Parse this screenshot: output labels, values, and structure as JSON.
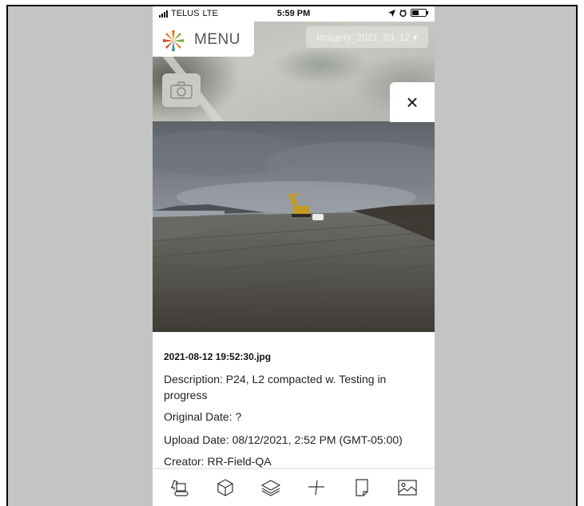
{
  "status_bar": {
    "carrier": "TELUS",
    "network": "LTE",
    "time": "5:59 PM"
  },
  "header": {
    "menu_label": "MENU",
    "imagery_select": "Imagery_2021_03_12 ▾"
  },
  "overlay": {
    "close_label": "×"
  },
  "photo_info": {
    "filename": "2021-08-12 19:52:30.jpg",
    "description": "Description: P24, L2 compacted w. Testing in progress",
    "original_date": "Original Date: ?",
    "upload_date": "Upload Date: 08/12/2021, 2:52 PM (GMT-05:00)",
    "creator": "Creator: RR-Field-QA"
  },
  "toolbar": {
    "items": [
      "excavator-icon",
      "cube-icon",
      "layers-icon",
      "measure-icon",
      "document-icon",
      "image-icon"
    ]
  },
  "colors": {
    "frame_background": "#c4c4c4",
    "logo_orange": "#e8792a",
    "logo_green": "#7aa83c",
    "logo_teal": "#2f8f9a",
    "logo_red": "#d24a2b"
  }
}
